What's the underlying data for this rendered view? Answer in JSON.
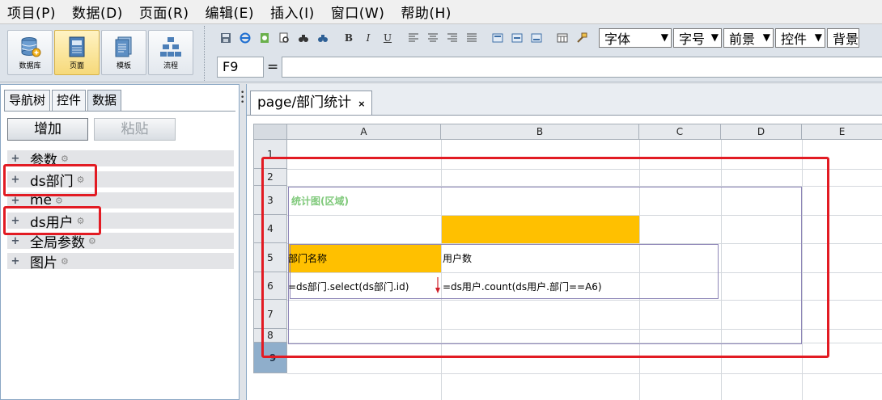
{
  "menubar": {
    "items": [
      "项目(P)",
      "数据(D)",
      "页面(R)",
      "编辑(E)",
      "插入(I)",
      "窗口(W)",
      "帮助(H)"
    ]
  },
  "toolbar": {
    "big_buttons": [
      {
        "label": "数据库",
        "icon": "database-icon"
      },
      {
        "label": "页面",
        "icon": "page-icon"
      },
      {
        "label": "模板",
        "icon": "template-icon"
      },
      {
        "label": "流程",
        "icon": "flow-icon"
      }
    ],
    "format_icons": [
      "save-icon",
      "ie-icon",
      "preview-icon",
      "print-preview-icon",
      "find-icon",
      "find-replace-icon",
      "bold-icon",
      "italic-icon",
      "underline-icon",
      "align-left-icon",
      "align-center-icon",
      "align-right-icon",
      "justify-icon",
      "valign-top-icon",
      "valign-middle-icon",
      "valign-bottom-icon",
      "merge-cells-icon",
      "format-painter-icon"
    ],
    "bold_glyph": "B",
    "italic_glyph": "I",
    "underline_glyph": "U",
    "selects": [
      "字体",
      "字号",
      "前景",
      "控件",
      "背景"
    ]
  },
  "formula_bar": {
    "cell_ref": "F9",
    "eq": "=",
    "value": ""
  },
  "left_panel": {
    "tabs": [
      "导航树",
      "控件",
      "数据"
    ],
    "active_tab": "数据",
    "add_button": "增加",
    "paste_button": "粘贴",
    "tree": [
      "参数",
      "ds部门",
      "me",
      "ds用户",
      "全局参数",
      "图片"
    ],
    "plus_glyph": "+",
    "gear_glyph": "⚙"
  },
  "document": {
    "tab_label": "page/部门统计",
    "close_glyph": "×",
    "columns": [
      "A",
      "B",
      "C",
      "D",
      "E"
    ],
    "rows": [
      "1",
      "2",
      "3",
      "4",
      "5",
      "6",
      "7",
      "8",
      "9"
    ],
    "selected_row": "9",
    "cells": {
      "a3": "统计图(区域)",
      "a5": "部门名称",
      "b5": "用户数",
      "a6": "=ds部门.select(ds部门.id)",
      "b6": "=ds用户.count(ds用户.部门==A6)"
    },
    "colors": {
      "header_fill": "#ffc000",
      "chart_label": "#7fc97a",
      "annotation": "#e21b23",
      "region_border": "#8e86b7"
    }
  }
}
